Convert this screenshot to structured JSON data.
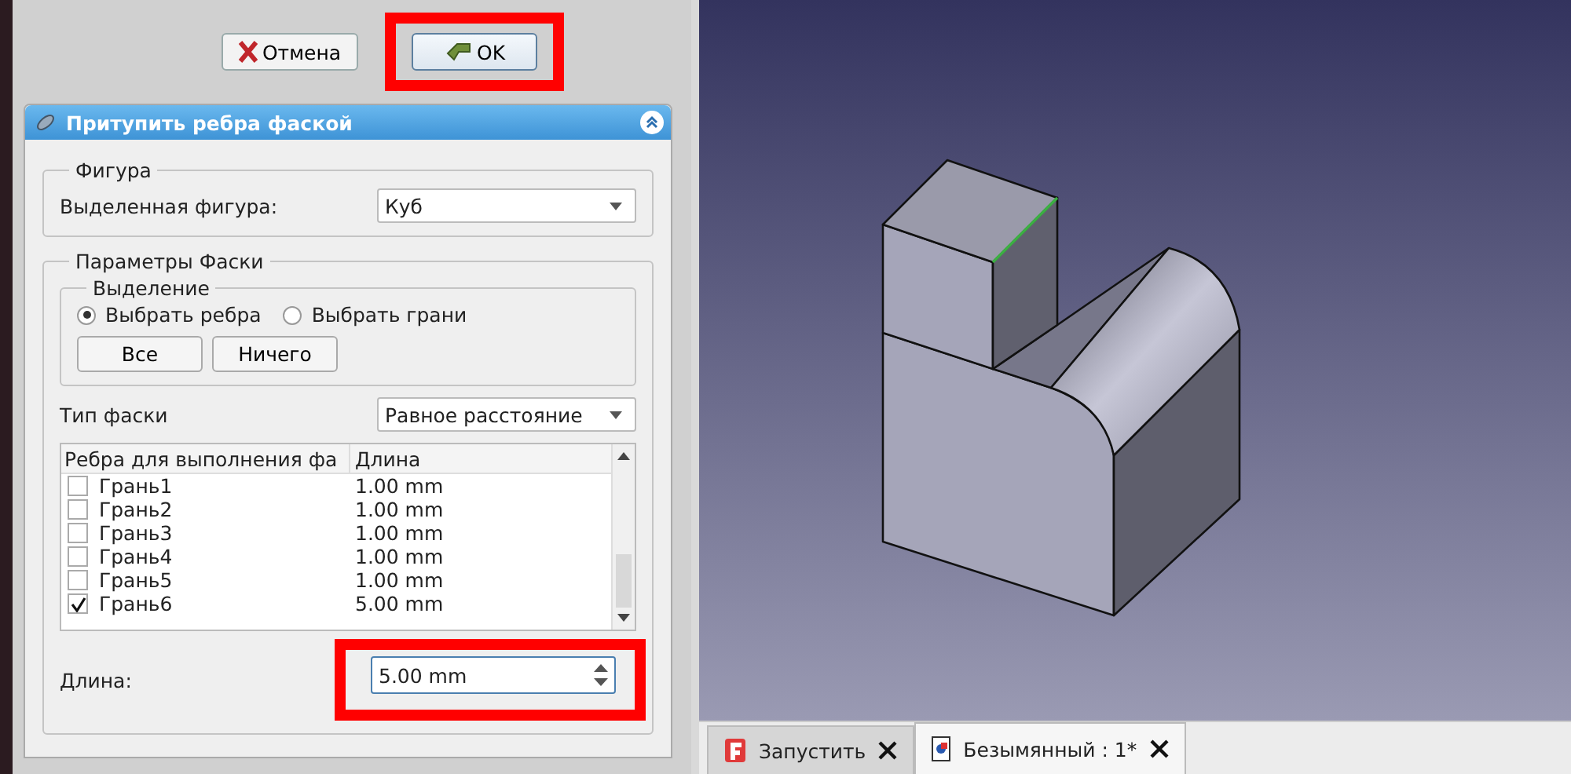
{
  "dialog": {
    "buttons": [
      {
        "label": "Отмена",
        "kind": "cancel",
        "highlighted": false
      },
      {
        "label": "OK",
        "kind": "ok",
        "highlighted": true
      }
    ],
    "task_panel": {
      "title": "Притупить ребра фаской",
      "expanded": true,
      "shape_group": {
        "title": "Фигура",
        "label": "Выделенная фигура:",
        "value": "Куб"
      },
      "params_group": {
        "title": "Параметры Фаски",
        "selection": {
          "title": "Выделение",
          "options": [
            {
              "label": "Выбрать ребра",
              "selected": true
            },
            {
              "label": "Выбрать грани",
              "selected": false
            }
          ],
          "buttons": [
            "Все",
            "Ничего"
          ]
        },
        "type_label": "Тип фаски",
        "type_value": "Равное расстояние",
        "table": {
          "columns": [
            "Ребра для выполнения фа",
            "Длина"
          ],
          "rows": [
            {
              "name": "Грань1",
              "length": "1.00 mm",
              "checked": false
            },
            {
              "name": "Грань2",
              "length": "1.00 mm",
              "checked": false
            },
            {
              "name": "Грань3",
              "length": "1.00 mm",
              "checked": false
            },
            {
              "name": "Грань4",
              "length": "1.00 mm",
              "checked": false
            },
            {
              "name": "Грань5",
              "length": "1.00 mm",
              "checked": false
            },
            {
              "name": "Грань6",
              "length": "5.00 mm",
              "checked": true
            }
          ]
        },
        "length_field": {
          "label": "Длина:",
          "value": "5.00 mm",
          "highlighted": true
        }
      }
    }
  },
  "tabs": [
    {
      "label": "Запустить",
      "kind": "start",
      "selected": false
    },
    {
      "label": "Безымянный : 1*",
      "kind": "document",
      "selected": true
    }
  ]
}
